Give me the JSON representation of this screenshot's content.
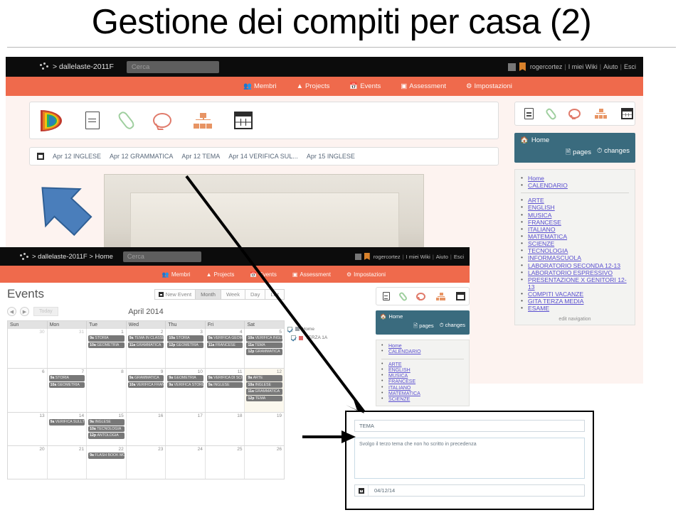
{
  "slide": {
    "title": "Gestione dei compiti per casa (2)"
  },
  "shot_top": {
    "topbar": {
      "breadcrumb": "> dallelaste-2011F",
      "search_placeholder": "Cerca",
      "user": "rogercortez",
      "links": [
        "I miei Wiki",
        "Aiuto",
        "Esci"
      ],
      "sep": "|"
    },
    "nav": [
      {
        "icon": "members-icon",
        "label": "Membri"
      },
      {
        "icon": "projects-icon",
        "label": "Projects"
      },
      {
        "icon": "events-icon",
        "label": "Events"
      },
      {
        "icon": "assessment-icon",
        "label": "Assessment"
      },
      {
        "icon": "settings-icon",
        "label": "Impostazioni"
      }
    ],
    "toolbar_icons": [
      "rainbow-icon",
      "page-icon",
      "paperclip-icon",
      "comment-icon",
      "sitemap-icon",
      "calendar-icon"
    ],
    "tabs": {
      "icon": "calendar-icon",
      "items": [
        "Apr 12 INGLESE",
        "Apr 12 GRAMMATICA",
        "Apr 12 TEMA",
        "Apr 14 VERIFICA SUL...",
        "Apr 15 INGLESE"
      ]
    }
  },
  "sidebar": {
    "icons": [
      "page-icon",
      "paperclip-icon",
      "comment-icon",
      "sitemap-icon",
      "calendar-icon"
    ],
    "home_label": "Home",
    "pages_label": "pages",
    "changes_label": "changes",
    "top_links": [
      "Home",
      "CALENDARIO"
    ],
    "links": [
      "ARTE",
      "ENGLISH",
      "MUSICA",
      "FRANCESE",
      "ITALIANO",
      "MATEMATICA",
      "SCIENZE",
      "TECNOLOGIA",
      "INFORMASCUOLA",
      "LABORATORIO SECONDA 12-13",
      "LABORATORIO ESPRESSIVO",
      "PRESENTAZIONE X GENITORI 12-13",
      "COMPITI VACANZE",
      "GITA TERZA MEDIA",
      "ESAME"
    ],
    "edit_nav": "edit navigation"
  },
  "shot_bottom": {
    "topbar": {
      "breadcrumb": "> dallelaste-2011F > Home",
      "search_placeholder": "Cerca",
      "user": "rogercortez",
      "links": [
        "I miei Wiki",
        "Aiuto",
        "Esci"
      ],
      "sep": "|"
    },
    "events": {
      "title": "Events",
      "new_event_label": "New Event",
      "views": [
        "Month",
        "Week",
        "Day",
        "List"
      ],
      "active_view": "Month",
      "today_label": "Today",
      "month_label": "April 2014",
      "weekdays": [
        "Sun",
        "Mon",
        "Tue",
        "Wed",
        "Thu",
        "Fri",
        "Sat"
      ],
      "filters": [
        {
          "label": "Home",
          "color": "#9aa0a6",
          "checked": true
        },
        {
          "label": "TERZA 1A",
          "color": "#e06666",
          "checked": true
        }
      ],
      "weeks": [
        {
          "days": [
            {
              "num": "30",
              "muted": true,
              "events": []
            },
            {
              "num": "31",
              "muted": true,
              "events": []
            },
            {
              "num": "1",
              "muted": false,
              "events": [
                {
                  "time": "9a",
                  "label": "STORIA"
                },
                {
                  "time": "10a",
                  "label": "GEOMETRIA"
                }
              ]
            },
            {
              "num": "2",
              "muted": false,
              "events": [
                {
                  "time": "9a",
                  "label": "TEMA IN CLASSE"
                },
                {
                  "time": "11a",
                  "label": "GRAMMATICA"
                }
              ]
            },
            {
              "num": "3",
              "muted": false,
              "events": [
                {
                  "time": "10a",
                  "label": "STORIA"
                },
                {
                  "time": "12p",
                  "label": "GEOMETRIA"
                }
              ]
            },
            {
              "num": "4",
              "muted": false,
              "events": [
                {
                  "time": "9a",
                  "label": "VERIFICA GEOMETRIA"
                },
                {
                  "time": "11a",
                  "label": "FRANCESE"
                }
              ]
            },
            {
              "num": "5",
              "muted": false,
              "events": [
                {
                  "time": "10a",
                  "label": "VERIFICA INGLESE"
                },
                {
                  "time": "11a",
                  "label": "TEMA"
                },
                {
                  "time": "12p",
                  "label": "GRAMMATICA"
                }
              ]
            }
          ]
        },
        {
          "days": [
            {
              "num": "6",
              "muted": false,
              "events": []
            },
            {
              "num": "7",
              "muted": false,
              "events": [
                {
                  "time": "9a",
                  "label": "STORIA"
                },
                {
                  "time": "10a",
                  "label": "GEOMETRIA"
                }
              ]
            },
            {
              "num": "8",
              "muted": false,
              "events": []
            },
            {
              "num": "9",
              "muted": false,
              "events": [
                {
                  "time": "9a",
                  "label": "GRAMMATICA"
                },
                {
                  "time": "10a",
                  "label": "VERIFICA FRANCESE"
                }
              ]
            },
            {
              "num": "10",
              "muted": false,
              "events": [
                {
                  "time": "9a",
                  "label": "GEOMETRIA"
                },
                {
                  "time": "9a",
                  "label": "VERIFICA STORIA"
                }
              ]
            },
            {
              "num": "11",
              "muted": false,
              "events": [
                {
                  "time": "9a",
                  "label": "VERIFICA DI SCIENZE"
                },
                {
                  "time": "9a",
                  "label": "INGLESE"
                }
              ]
            },
            {
              "num": "12",
              "muted": true,
              "events": [
                {
                  "time": "9a",
                  "label": "ARTE"
                },
                {
                  "time": "10a",
                  "label": "INGLESE"
                },
                {
                  "time": "11a",
                  "label": "GRAMMATICA"
                },
                {
                  "time": "12p",
                  "label": "TEMA"
                }
              ]
            }
          ]
        },
        {
          "days": [
            {
              "num": "13",
              "muted": false,
              "events": []
            },
            {
              "num": "14",
              "muted": false,
              "events": [
                {
                  "time": "9a",
                  "label": "VERIFICA SULL'IVA"
                }
              ]
            },
            {
              "num": "15",
              "muted": false,
              "events": [
                {
                  "time": "9a",
                  "label": "INGLESE"
                },
                {
                  "time": "10a",
                  "label": "TECNOLOGIA"
                },
                {
                  "time": "12p",
                  "label": "ANTOLOGIA"
                }
              ]
            },
            {
              "num": "16",
              "muted": false,
              "events": []
            },
            {
              "num": "17",
              "muted": false,
              "events": []
            },
            {
              "num": "18",
              "muted": false,
              "events": []
            },
            {
              "num": "19",
              "muted": false,
              "events": []
            }
          ]
        },
        {
          "days": [
            {
              "num": "20",
              "muted": false,
              "events": []
            },
            {
              "num": "21",
              "muted": false,
              "events": []
            },
            {
              "num": "22",
              "muted": false,
              "events": [
                {
                  "time": "9a",
                  "label": "FLASH BOOK MODE"
                }
              ]
            },
            {
              "num": "23",
              "muted": false,
              "events": []
            },
            {
              "num": "24",
              "muted": false,
              "events": []
            },
            {
              "num": "25",
              "muted": false,
              "events": []
            },
            {
              "num": "26",
              "muted": false,
              "events": []
            }
          ]
        }
      ]
    }
  },
  "dialog": {
    "title_value": "TEMA",
    "description_value": "Svolgo il terzo tema che non ho scritto in precedenza",
    "date_value": "04/12/14",
    "date_icon": "calendar-icon"
  }
}
